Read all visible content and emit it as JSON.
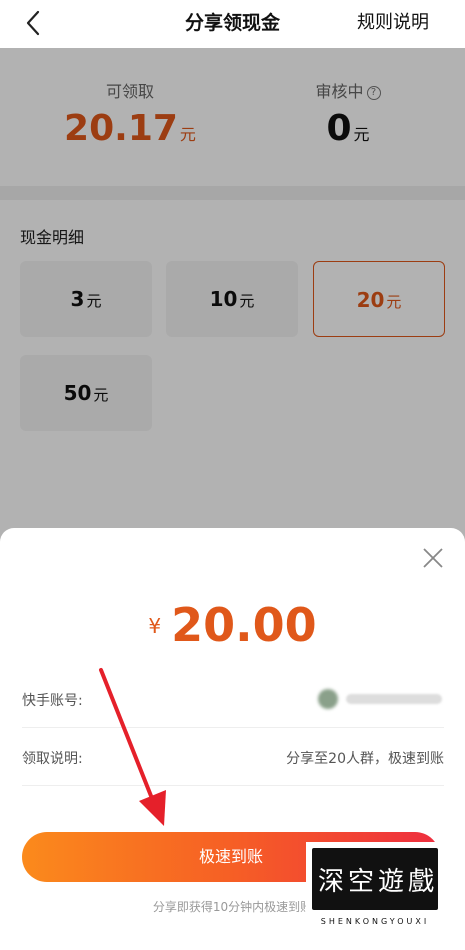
{
  "header": {
    "title": "分享领现金",
    "rules_label": "规则说明"
  },
  "stats": {
    "claimable_label": "可领取",
    "claimable_value": "20.17",
    "claimable_unit": "元",
    "reviewing_label": "审核中",
    "reviewing_value": "0",
    "reviewing_unit": "元"
  },
  "detail": {
    "title": "现金明细",
    "options": [
      {
        "amount": "3",
        "unit": "元"
      },
      {
        "amount": "10",
        "unit": "元"
      },
      {
        "amount": "20",
        "unit": "元",
        "selected": true
      },
      {
        "amount": "50",
        "unit": "元"
      }
    ]
  },
  "sheet": {
    "currency": "¥",
    "amount": "20.00",
    "account_label": "快手账号:",
    "claim_desc_label": "领取说明:",
    "claim_desc_value": "分享至20人群，极速到账",
    "button_label": "极速到账",
    "note": "分享即获得10分钟内极速到账"
  },
  "watermark": {
    "chars": [
      "深",
      "空",
      "遊",
      "戲"
    ],
    "subtitle": "SHENKONGYOUXI"
  },
  "colors": {
    "accent": "#e0581a",
    "button_start": "#fb8a1c",
    "button_end": "#ee2e3f",
    "arrow": "#e5202a"
  }
}
